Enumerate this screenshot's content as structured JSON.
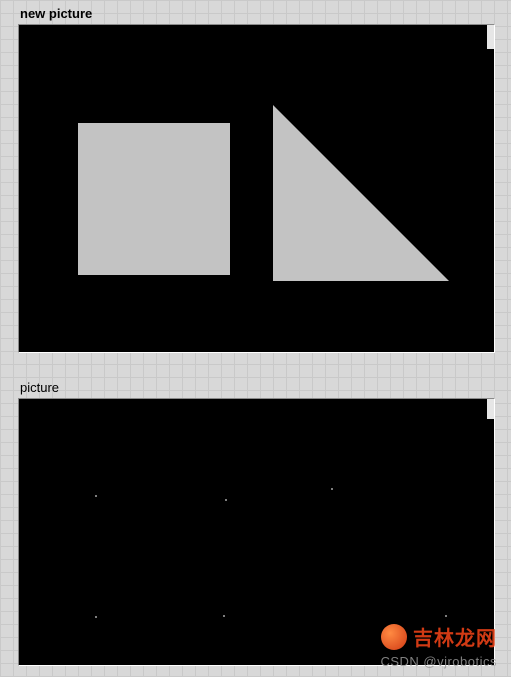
{
  "panels": {
    "top": {
      "label": "new picture"
    },
    "bottom": {
      "label": "picture"
    }
  },
  "shapes": {
    "square_color": "#c3c3c3",
    "triangle_color": "#c3c3c3",
    "canvas_bg": "#000000"
  },
  "watermark": {
    "site_cn": "吉林龙网",
    "csdn": "CSDN @vjrobotics"
  }
}
